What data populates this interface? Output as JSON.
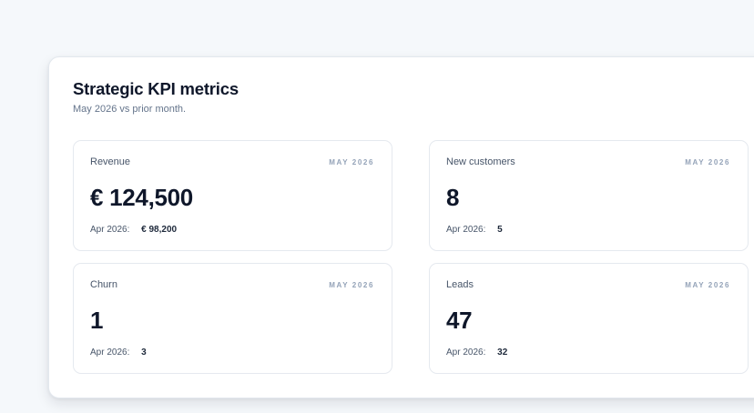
{
  "panel": {
    "title": "Strategic KPI metrics",
    "subtitle": "May 2026 vs prior month."
  },
  "cards": [
    {
      "label": "Revenue",
      "period": "MAY 2026",
      "value": "€ 124,500",
      "prior_label": "Apr 2026:",
      "prior_value": "€ 98,200"
    },
    {
      "label": "New customers",
      "period": "MAY 2026",
      "value": "8",
      "prior_label": "Apr 2026:",
      "prior_value": "5"
    },
    {
      "label": "Churn",
      "period": "MAY 2026",
      "value": "1",
      "prior_label": "Apr 2026:",
      "prior_value": "3"
    },
    {
      "label": "Leads",
      "period": "MAY 2026",
      "value": "47",
      "prior_label": "Apr 2026:",
      "prior_value": "32"
    }
  ]
}
